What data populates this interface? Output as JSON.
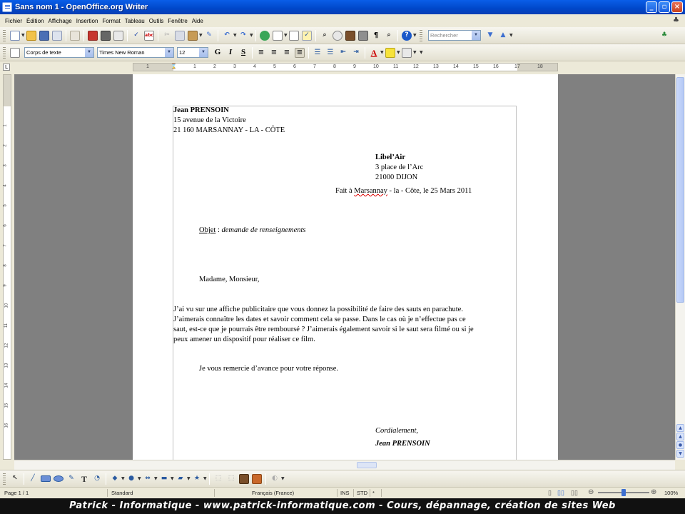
{
  "window": {
    "title": "Sans nom 1 - OpenOffice.org Writer",
    "minimize": "_",
    "maximize": "▫",
    "close": "×"
  },
  "menu": [
    "Fichier",
    "Édition",
    "Affichage",
    "Insertion",
    "Format",
    "Tableau",
    "Outils",
    "Fenêtre",
    "Aide"
  ],
  "toolbar_format": {
    "style_value": "Corps de texte",
    "font_value": "Times New Roman",
    "size_value": "12",
    "bold": "G",
    "italic": "I",
    "underline": "S",
    "font_color": "A"
  },
  "toolbar_standard": {
    "search_placeholder": "Rechercher"
  },
  "ruler": {
    "ticks": [
      "1",
      "1",
      "2",
      "3",
      "4",
      "5",
      "6",
      "7",
      "8",
      "9",
      "10",
      "11",
      "12",
      "13",
      "14",
      "15",
      "16",
      "17",
      "18"
    ]
  },
  "vruler": {
    "ticks": [
      "1",
      "2",
      "3",
      "4",
      "5",
      "6",
      "7",
      "8",
      "9",
      "10",
      "11",
      "12",
      "13",
      "14",
      "15",
      "16"
    ]
  },
  "document": {
    "sender_name": "Jean PRENSOIN",
    "sender_street": "15 avenue de la Victoire",
    "sender_city": "21 160 MARSANNAY - LA - CÔTE",
    "recipient_name": "Libel’Air",
    "recipient_street": "3 place de l’Arc",
    "recipient_city": "21000 DIJON",
    "date_prefix": "Fait à ",
    "date_place": "Marsannay",
    "date_rest": " - la - Côte, le 25 Mars 2011",
    "object_label": "Objet",
    "object_sep": " : ",
    "object_text": "demande de renseignements",
    "salutation": "Madame, Monsieur,",
    "body_lines": [
      "J’ai vu sur une affiche publicitaire que vous donnez la possibilité de faire des sauts en parachute.",
      "J’aimerais connaître les dates et savoir comment cela se passe. Dans le cas où je n’effectue pas ce",
      "saut, est-ce que je pourrais être remboursé ? J’aimerais également savoir si le saut sera filmé ou si je",
      "peux amener un dispositif pour réaliser ce film."
    ],
    "thanks": "Je vous remercie d’avance pour votre réponse.",
    "closing": "Cordialement,",
    "signature": "Jean PRENSOIN"
  },
  "status": {
    "page": "Page 1 / 1",
    "style": "Standard",
    "language": "Français (France)",
    "ins": "INS",
    "std": "STD",
    "star": "*",
    "zoom": "100%",
    "zoom_level": 0.5
  },
  "banner": "Patrick - Informatique - www.patrick-informatique.com - Cours, dépannage, création de sites Web"
}
